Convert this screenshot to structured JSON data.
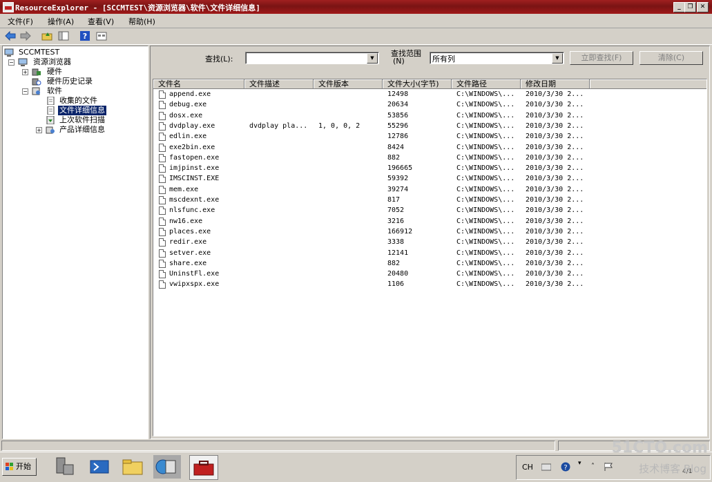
{
  "window": {
    "title": "ResourceExplorer - [SCCMTEST\\资源浏览器\\软件\\文件详细信息]",
    "min": "_",
    "restore": "❐",
    "close": "✕"
  },
  "menu": {
    "items": [
      "文件(F)",
      "操作(A)",
      "查看(V)",
      "帮助(H)"
    ]
  },
  "toolbar": {
    "icons": [
      "back-arrow-icon",
      "forward-arrow-icon",
      "up-folder-icon",
      "show-hide-tree-icon",
      "help-icon",
      "properties-icon"
    ]
  },
  "tree": {
    "nodes": [
      {
        "label": "SCCMTEST",
        "icon": "computer-icon"
      },
      {
        "label": "资源浏览器",
        "icon": "computer-icon",
        "expander": "−"
      },
      {
        "label": "硬件",
        "icon": "hardware-icon",
        "expander": "+"
      },
      {
        "label": "硬件历史记录",
        "icon": "hardware-history-icon"
      },
      {
        "label": "软件",
        "icon": "software-icon",
        "expander": "−"
      },
      {
        "label": "收集的文件",
        "icon": "document-icon"
      },
      {
        "label": "文件详细信息",
        "icon": "document-icon",
        "selected": true
      },
      {
        "label": "上次软件扫描",
        "icon": "scan-icon"
      },
      {
        "label": "产品详细信息",
        "icon": "product-icon",
        "expander": "+"
      }
    ]
  },
  "search": {
    "find_label": "查找(L):",
    "find_value": "",
    "scope_label_line1": "查找范围",
    "scope_label_line2": "(N)",
    "scope_value": "所有列",
    "find_now_button": "立即查找(F)",
    "clear_button": "清除(C)"
  },
  "table": {
    "columns": [
      "文件名",
      "文件描述",
      "文件版本",
      "文件大小(字节)",
      "文件路径",
      "修改日期"
    ],
    "rows": [
      {
        "name": "append.exe",
        "desc": "",
        "ver": "",
        "size": "12498",
        "path": "C:\\WINDOWS\\...",
        "date": "2010/3/30 2..."
      },
      {
        "name": "debug.exe",
        "desc": "",
        "ver": "",
        "size": "20634",
        "path": "C:\\WINDOWS\\...",
        "date": "2010/3/30 2..."
      },
      {
        "name": "dosx.exe",
        "desc": "",
        "ver": "",
        "size": "53856",
        "path": "C:\\WINDOWS\\...",
        "date": "2010/3/30 2..."
      },
      {
        "name": "dvdplay.exe",
        "desc": "dvdplay pla...",
        "ver": "1, 0, 0, 2",
        "size": "55296",
        "path": "C:\\WINDOWS\\...",
        "date": "2010/3/30 2..."
      },
      {
        "name": "edlin.exe",
        "desc": "",
        "ver": "",
        "size": "12786",
        "path": "C:\\WINDOWS\\...",
        "date": "2010/3/30 2..."
      },
      {
        "name": "exe2bin.exe",
        "desc": "",
        "ver": "",
        "size": "8424",
        "path": "C:\\WINDOWS\\...",
        "date": "2010/3/30 2..."
      },
      {
        "name": "fastopen.exe",
        "desc": "",
        "ver": "",
        "size": "882",
        "path": "C:\\WINDOWS\\...",
        "date": "2010/3/30 2..."
      },
      {
        "name": "imjpinst.exe",
        "desc": "",
        "ver": "",
        "size": "196665",
        "path": "C:\\WINDOWS\\...",
        "date": "2010/3/30 2..."
      },
      {
        "name": "IMSCINST.EXE",
        "desc": "",
        "ver": "",
        "size": "59392",
        "path": "C:\\WINDOWS\\...",
        "date": "2010/3/30 2..."
      },
      {
        "name": "mem.exe",
        "desc": "",
        "ver": "",
        "size": "39274",
        "path": "C:\\WINDOWS\\...",
        "date": "2010/3/30 2..."
      },
      {
        "name": "mscdexnt.exe",
        "desc": "",
        "ver": "",
        "size": "817",
        "path": "C:\\WINDOWS\\...",
        "date": "2010/3/30 2..."
      },
      {
        "name": "nlsfunc.exe",
        "desc": "",
        "ver": "",
        "size": "7052",
        "path": "C:\\WINDOWS\\...",
        "date": "2010/3/30 2..."
      },
      {
        "name": "nw16.exe",
        "desc": "",
        "ver": "",
        "size": "3216",
        "path": "C:\\WINDOWS\\...",
        "date": "2010/3/30 2..."
      },
      {
        "name": "places.exe",
        "desc": "",
        "ver": "",
        "size": "166912",
        "path": "C:\\WINDOWS\\...",
        "date": "2010/3/30 2..."
      },
      {
        "name": "redir.exe",
        "desc": "",
        "ver": "",
        "size": "3338",
        "path": "C:\\WINDOWS\\...",
        "date": "2010/3/30 2..."
      },
      {
        "name": "setver.exe",
        "desc": "",
        "ver": "",
        "size": "12141",
        "path": "C:\\WINDOWS\\...",
        "date": "2010/3/30 2..."
      },
      {
        "name": "share.exe",
        "desc": "",
        "ver": "",
        "size": "882",
        "path": "C:\\WINDOWS\\...",
        "date": "2010/3/30 2..."
      },
      {
        "name": "UninstFl.exe",
        "desc": "",
        "ver": "",
        "size": "20480",
        "path": "C:\\WINDOWS\\...",
        "date": "2010/3/30 2..."
      },
      {
        "name": "vwipxspx.exe",
        "desc": "",
        "ver": "",
        "size": "1106",
        "path": "C:\\WINDOWS\\...",
        "date": "2010/3/30 2..."
      }
    ]
  },
  "taskbar": {
    "start_label": "开始",
    "apps": [
      "server-manager-icon",
      "powershell-icon",
      "explorer-folder-icon",
      "calculator-app-icon",
      "toolbox-icon"
    ],
    "tray_lang": "CH",
    "clock": "4/1"
  },
  "watermark": {
    "line1": "51CTO.com",
    "line2": "技术博客 Blog"
  },
  "colors": {
    "title_bar": "#8c1818",
    "selection": "#0a246a",
    "chrome": "#d4d0c8"
  }
}
